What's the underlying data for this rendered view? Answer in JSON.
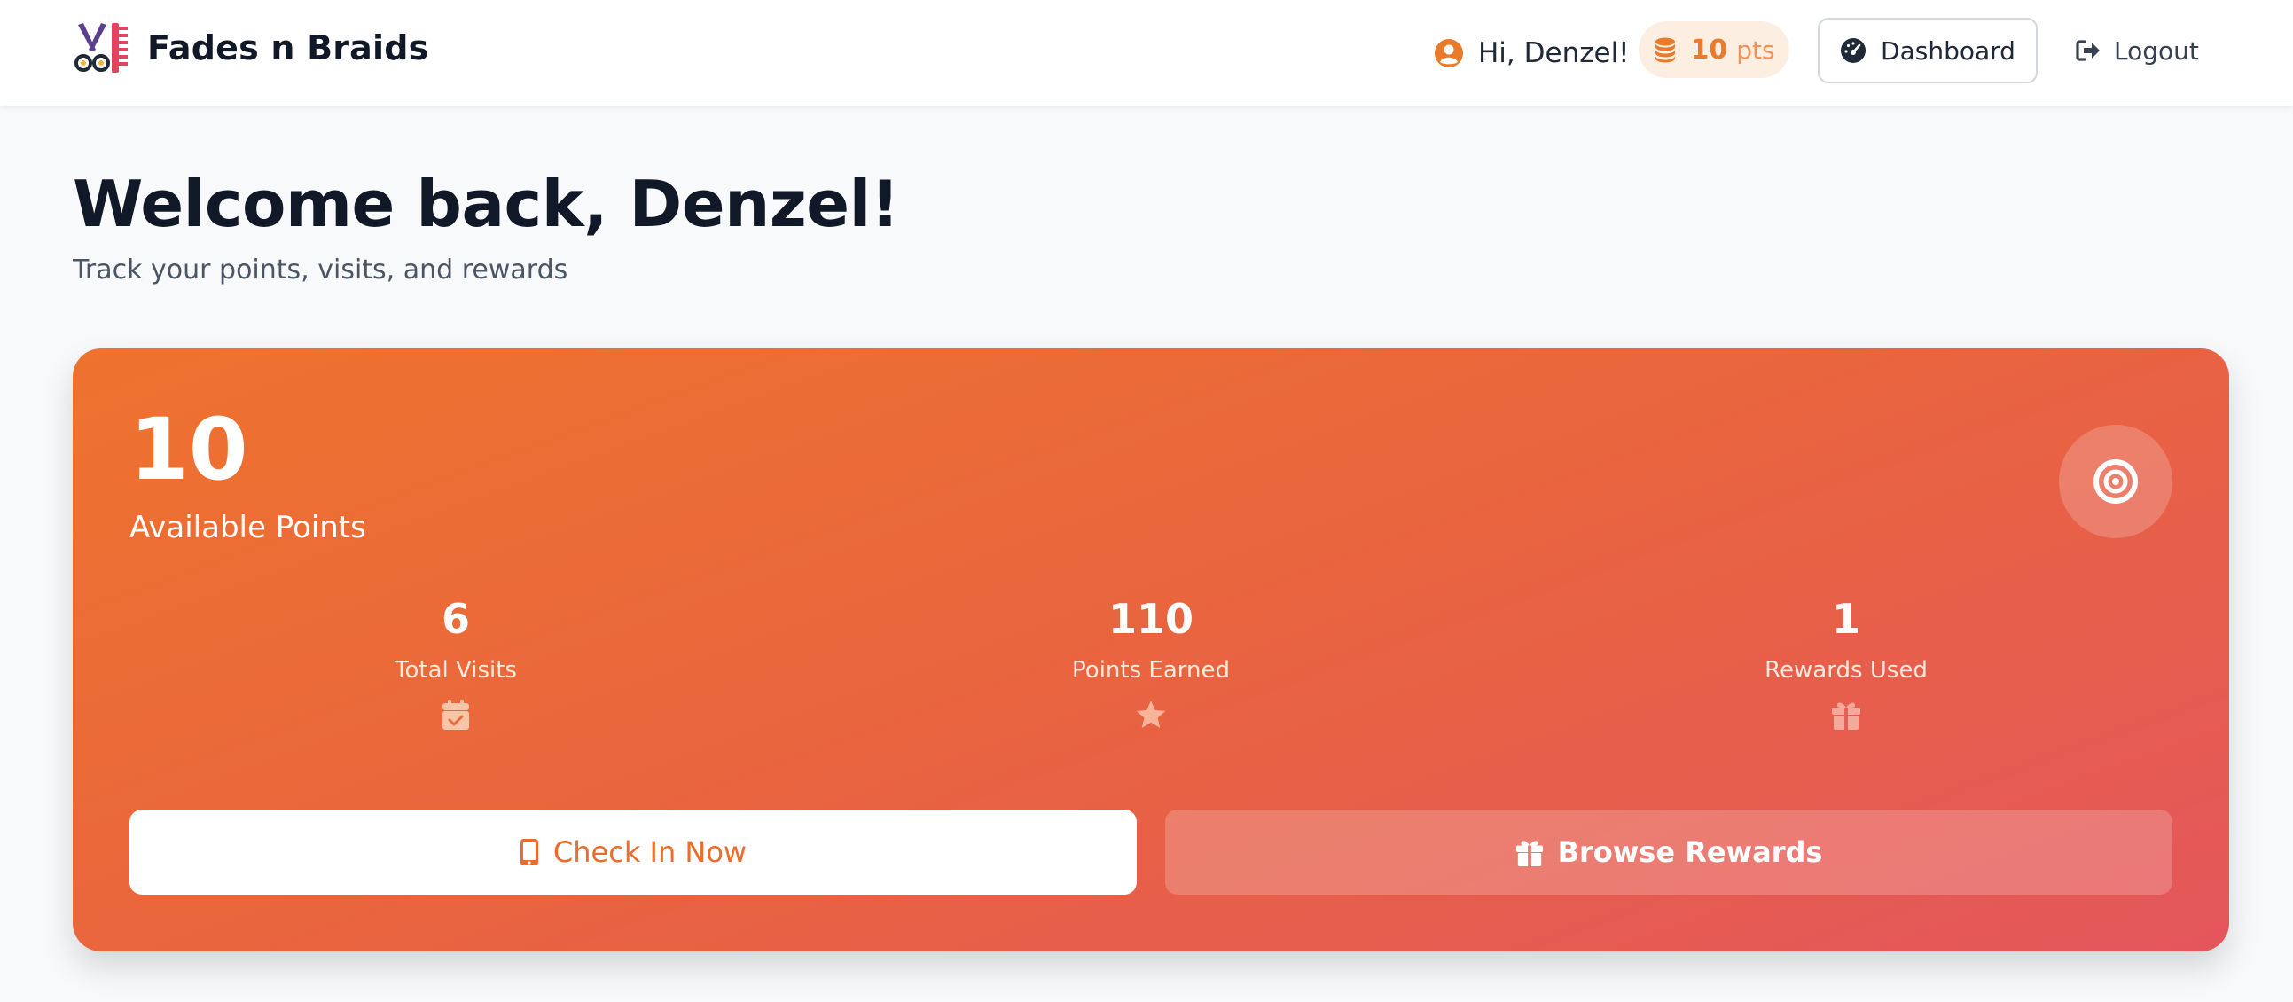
{
  "brand": {
    "name": "Fades n Braids",
    "logo_icon": "scissors-comb-icon"
  },
  "header": {
    "greeting": "Hi, Denzel!",
    "user_icon": "user-circle-icon",
    "points_badge": {
      "value": "10",
      "unit": "pts",
      "icon": "coins-icon"
    },
    "dashboard_label": "Dashboard",
    "dashboard_icon": "gauge-icon",
    "logout_label": "Logout",
    "logout_icon": "sign-out-icon"
  },
  "page": {
    "title": "Welcome back, Denzel!",
    "subtitle": "Track your points, visits, and rewards"
  },
  "points_card": {
    "available_points": "10",
    "available_label": "Available Points",
    "badge_icon": "target-icon",
    "stats": [
      {
        "value": "6",
        "label": "Total Visits",
        "icon": "calendar-check-icon"
      },
      {
        "value": "110",
        "label": "Points Earned",
        "icon": "star-icon"
      },
      {
        "value": "1",
        "label": "Rewards Used",
        "icon": "gift-icon"
      }
    ],
    "check_in_label": "Check In Now",
    "check_in_icon": "mobile-phone-icon",
    "browse_label": "Browse Rewards",
    "browse_icon": "gift-icon"
  },
  "colors": {
    "accent": "#ea7a2c",
    "card_gradient_start": "#ee732e",
    "card_gradient_end": "#e4565c",
    "text_dark": "#111827"
  }
}
